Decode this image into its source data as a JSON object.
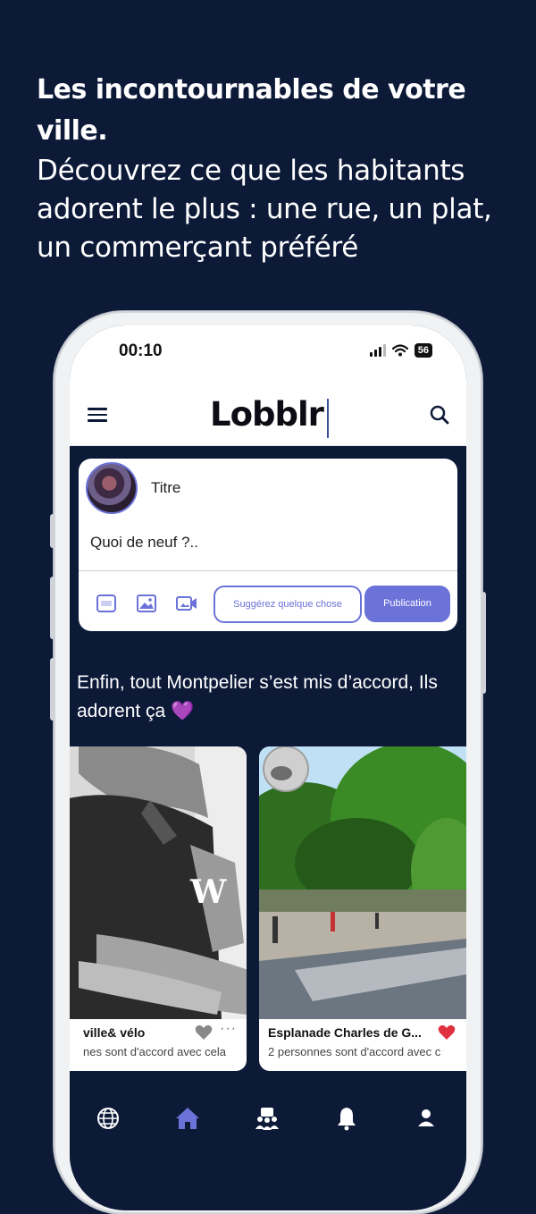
{
  "hero": {
    "title": "Les incontournables de votre ville.",
    "subtitle": "Découvrez ce que les habitants adorent le plus : une rue, un plat, un commerçant préféré"
  },
  "status_bar": {
    "time": "00:10",
    "battery": "56"
  },
  "app_bar": {
    "logo": "Lobblr",
    "menu_icon": "menu-icon",
    "search_icon": "search-icon"
  },
  "post_composer": {
    "title": "Titre",
    "input_text": "Quoi de neuf ?..",
    "tools": [
      "gif-icon",
      "image-icon",
      "video-icon"
    ],
    "suggest_label": "Suggérez quelque chose",
    "publish_label": "Publication"
  },
  "section": {
    "text": "Enfin, tout Montpelier s’est mis d’accord, Ils adorent ça 💜"
  },
  "cards": [
    {
      "title": "ville& vélo",
      "subtitle": "nes sont d'accord avec cela",
      "liked": false
    },
    {
      "title": "Esplanade Charles de G...",
      "subtitle": "2 personnes sont d'accord avec c",
      "liked": true
    }
  ],
  "tab_bar": {
    "items": [
      "globe-icon",
      "home-icon",
      "community-icon",
      "bell-icon",
      "profile-icon"
    ],
    "active": "home-icon"
  },
  "colors": {
    "background": "#0c1a38",
    "accent": "#6b72d8",
    "heart_active": "#e0323e",
    "heart_inactive": "#888888"
  }
}
